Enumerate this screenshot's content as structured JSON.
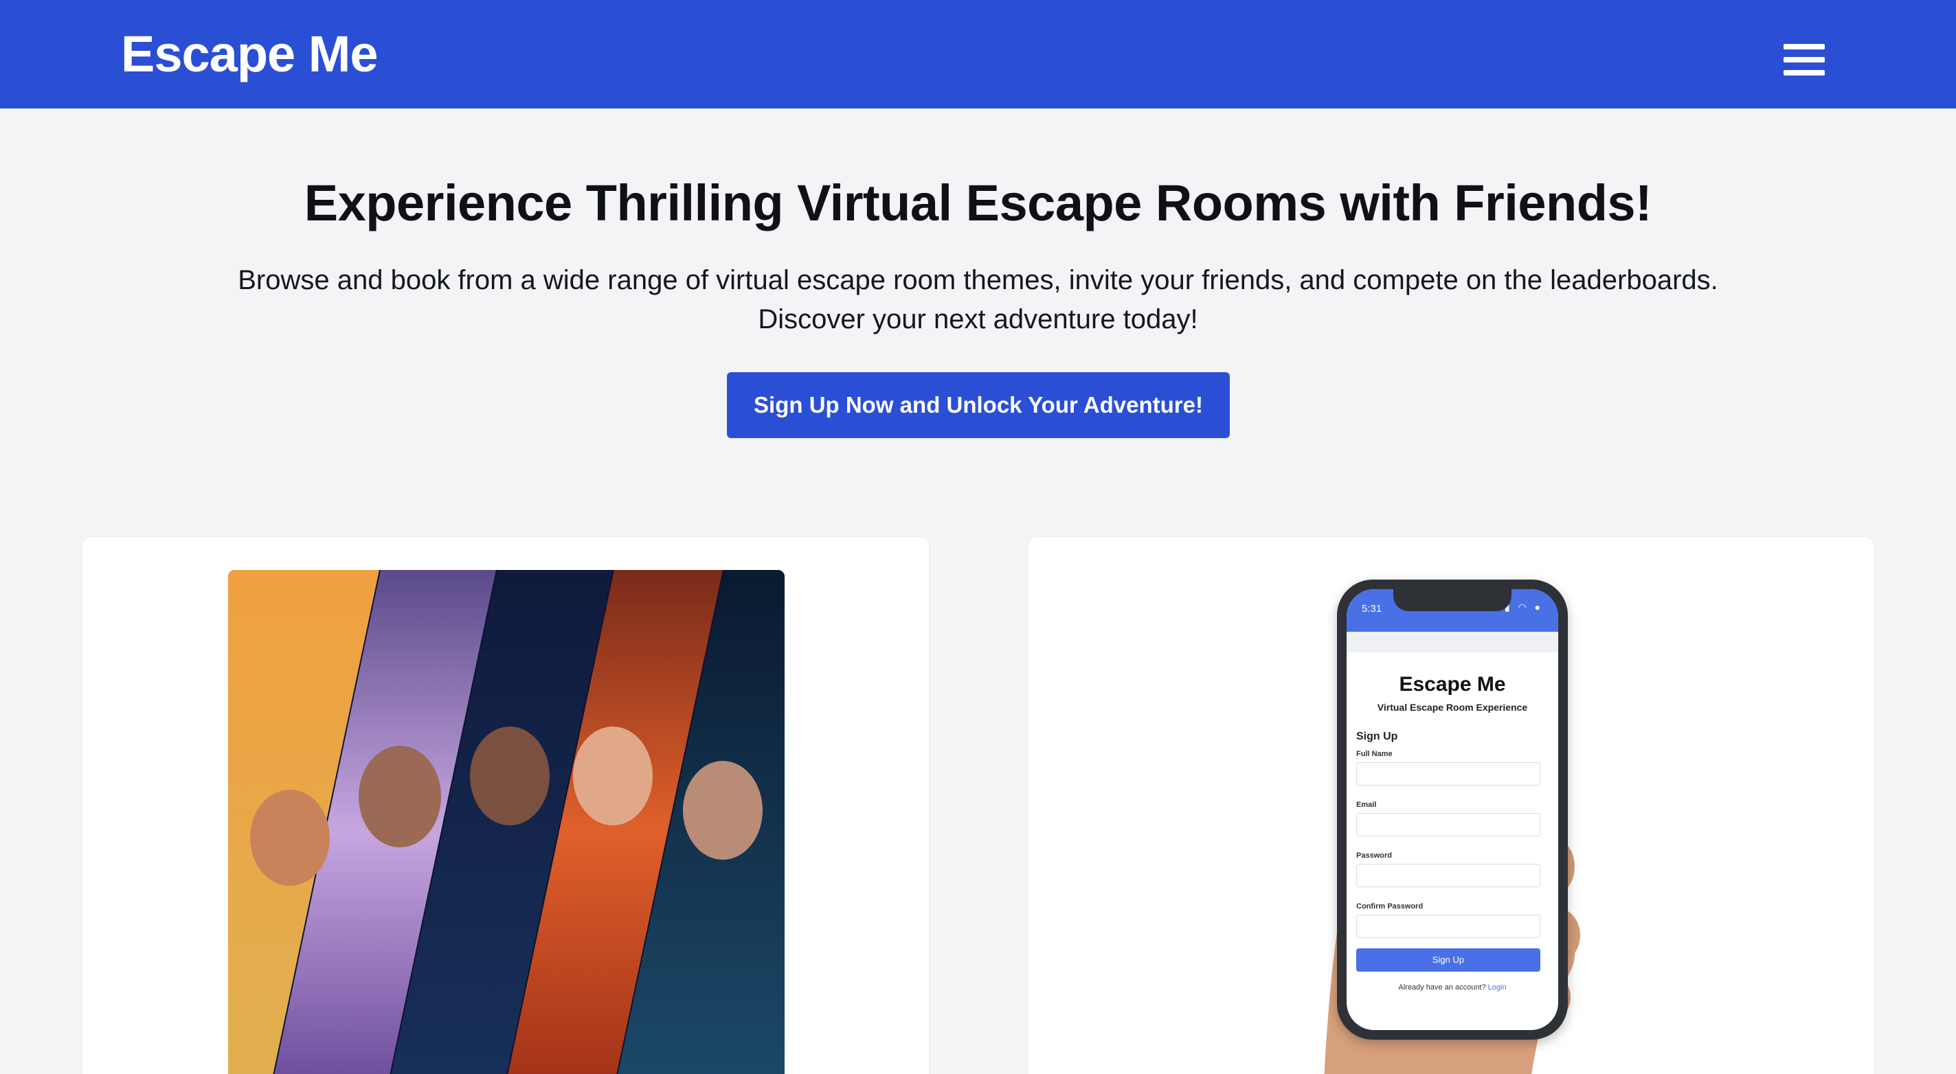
{
  "nav": {
    "brand": "Escape Me",
    "menu_icon": "hamburger-menu-icon"
  },
  "hero": {
    "title": "Experience Thrilling Virtual Escape Rooms with Friends!",
    "subtitle": "Browse and book from a wide range of virtual escape room themes, invite your friends, and compete on the leaderboards. Discover your next adventure today!",
    "cta_label": "Sign Up Now and Unlock Your Adventure!"
  },
  "colors": {
    "primary": "#2b4fd4",
    "background": "#f3f4f6",
    "card": "#ffffff",
    "mockup_accent": "#4a70e6"
  },
  "cards": {
    "left": {
      "image": "escape-room-movie-collage"
    },
    "right": {
      "image": "hand-holding-phone",
      "mockup": {
        "status_time": "5:31",
        "app_title": "Escape Me",
        "app_subtitle": "Virtual Escape Room Experience",
        "form_title": "Sign Up",
        "fields": [
          "Full Name",
          "Email",
          "Password",
          "Confirm Password"
        ],
        "button_label": "Sign Up",
        "login_prompt": "Already have an account?",
        "login_link": "Login"
      }
    }
  }
}
